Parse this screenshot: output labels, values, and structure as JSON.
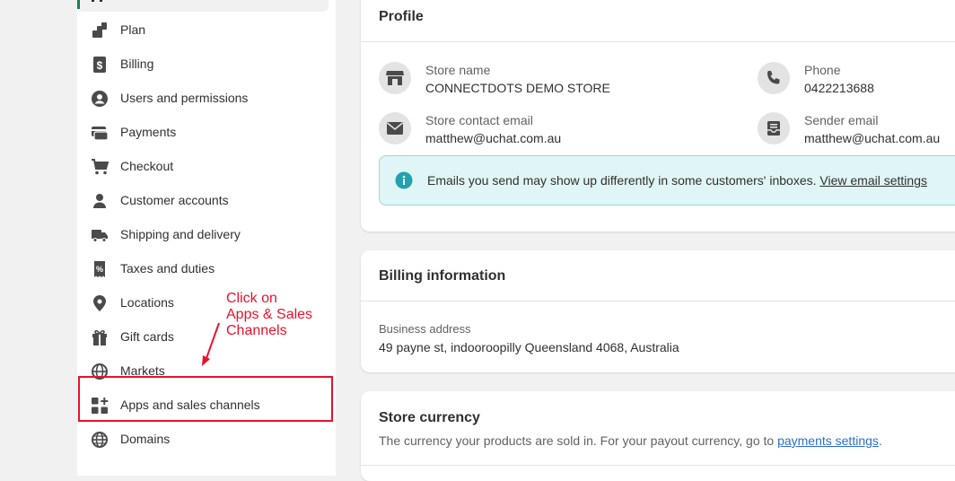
{
  "sidebar": {
    "items": [
      {
        "label": "Plan",
        "icon": "plan-icon"
      },
      {
        "label": "Billing",
        "icon": "dollar-icon"
      },
      {
        "label": "Users and permissions",
        "icon": "user-circle-icon"
      },
      {
        "label": "Payments",
        "icon": "payments-icon"
      },
      {
        "label": "Checkout",
        "icon": "cart-icon"
      },
      {
        "label": "Customer accounts",
        "icon": "person-icon"
      },
      {
        "label": "Shipping and delivery",
        "icon": "truck-icon"
      },
      {
        "label": "Taxes and duties",
        "icon": "receipt-icon"
      },
      {
        "label": "Locations",
        "icon": "location-pin-icon"
      },
      {
        "label": "Gift cards",
        "icon": "gift-icon"
      },
      {
        "label": "Markets",
        "icon": "globe-icon"
      },
      {
        "label": "Apps and sales channels",
        "icon": "apps-plus-icon"
      },
      {
        "label": "Domains",
        "icon": "globe-icon"
      }
    ]
  },
  "annotation": {
    "line1": "Click on",
    "line2": "Apps & Sales",
    "line3": "Channels",
    "color": "#e8112d"
  },
  "profile": {
    "title": "Profile",
    "store_name_label": "Store name",
    "store_name": "CONNECTDOTS DEMO STORE",
    "phone_label": "Phone",
    "phone": "0422213688",
    "contact_email_label": "Store contact email",
    "contact_email": "matthew@uchat.com.au",
    "sender_email_label": "Sender email",
    "sender_email": "matthew@uchat.com.au",
    "banner_text": "Emails you send may show up differently in some customers' inboxes.",
    "banner_link": "View email settings"
  },
  "billing": {
    "title": "Billing information",
    "address_label": "Business address",
    "address": "49 payne st, indooroopilly Queensland 4068, Australia"
  },
  "currency": {
    "title": "Store currency",
    "description": "The currency your products are sold in. For your payout currency, go to",
    "link": "payments settings",
    "after_link": "."
  },
  "colors": {
    "accent_green": "#1a7f54",
    "info_teal": "#22a1b1",
    "link_blue": "#2c6ecb",
    "annotation_red": "#e8112d"
  }
}
